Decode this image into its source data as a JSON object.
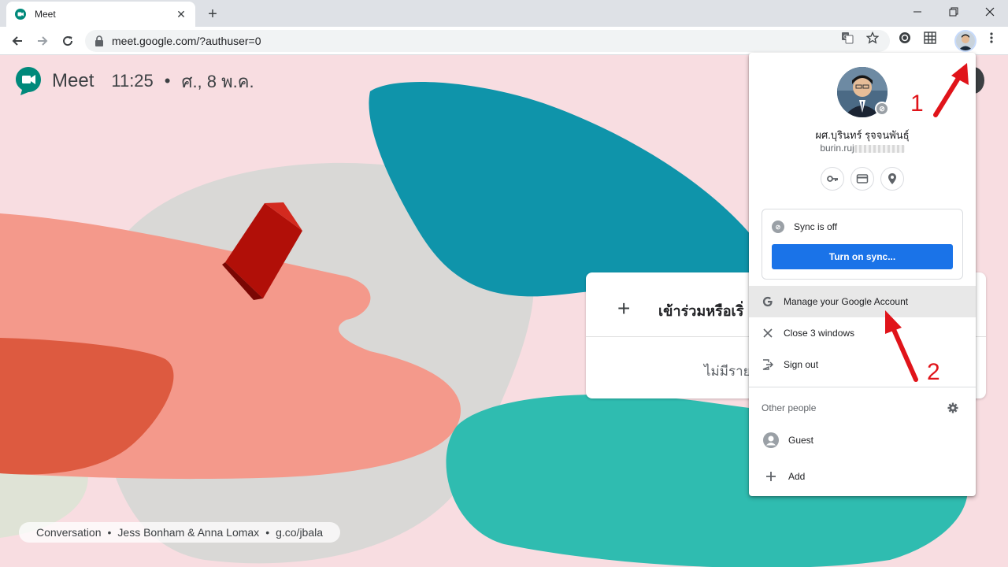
{
  "browser": {
    "tab_title": "Meet",
    "url": "meet.google.com/?authuser=0"
  },
  "meet": {
    "title": "Meet",
    "time": "11:25",
    "separator": "•",
    "date": "ศ., 8 พ.ค."
  },
  "card": {
    "join_label": "เข้าร่วมหรือเริ่",
    "empty_text": "ไม่มีราย"
  },
  "credit": {
    "parts": [
      "Conversation",
      "Jess Bonham & Anna Lomax",
      "g.co/jbala"
    ],
    "separator": "•"
  },
  "profile_menu": {
    "name": "ผศ.บุรินทร์ รุจจนพันธุ์",
    "email": "burin.ruj",
    "quick_actions": [
      "key-icon",
      "credit-card-icon",
      "location-pin-icon"
    ],
    "sync_status": "Sync is off",
    "sync_button": "Turn on sync...",
    "items": [
      {
        "label": "Manage your Google Account",
        "icon": "google-g-icon"
      },
      {
        "label": "Close 3 windows",
        "icon": "close-icon"
      },
      {
        "label": "Sign out",
        "icon": "sign-out-icon"
      }
    ],
    "other_people_label": "Other people",
    "people": [
      {
        "label": "Guest",
        "icon": "guest-avatar-icon"
      },
      {
        "label": "Add",
        "icon": "plus-icon"
      }
    ]
  },
  "annotations": {
    "step1": "1",
    "step2": "2",
    "color": "#e0141a"
  },
  "colors": {
    "accent_blue": "#1a73e8",
    "meet_green": "#00897b",
    "background_pink": "#f8dde1"
  }
}
